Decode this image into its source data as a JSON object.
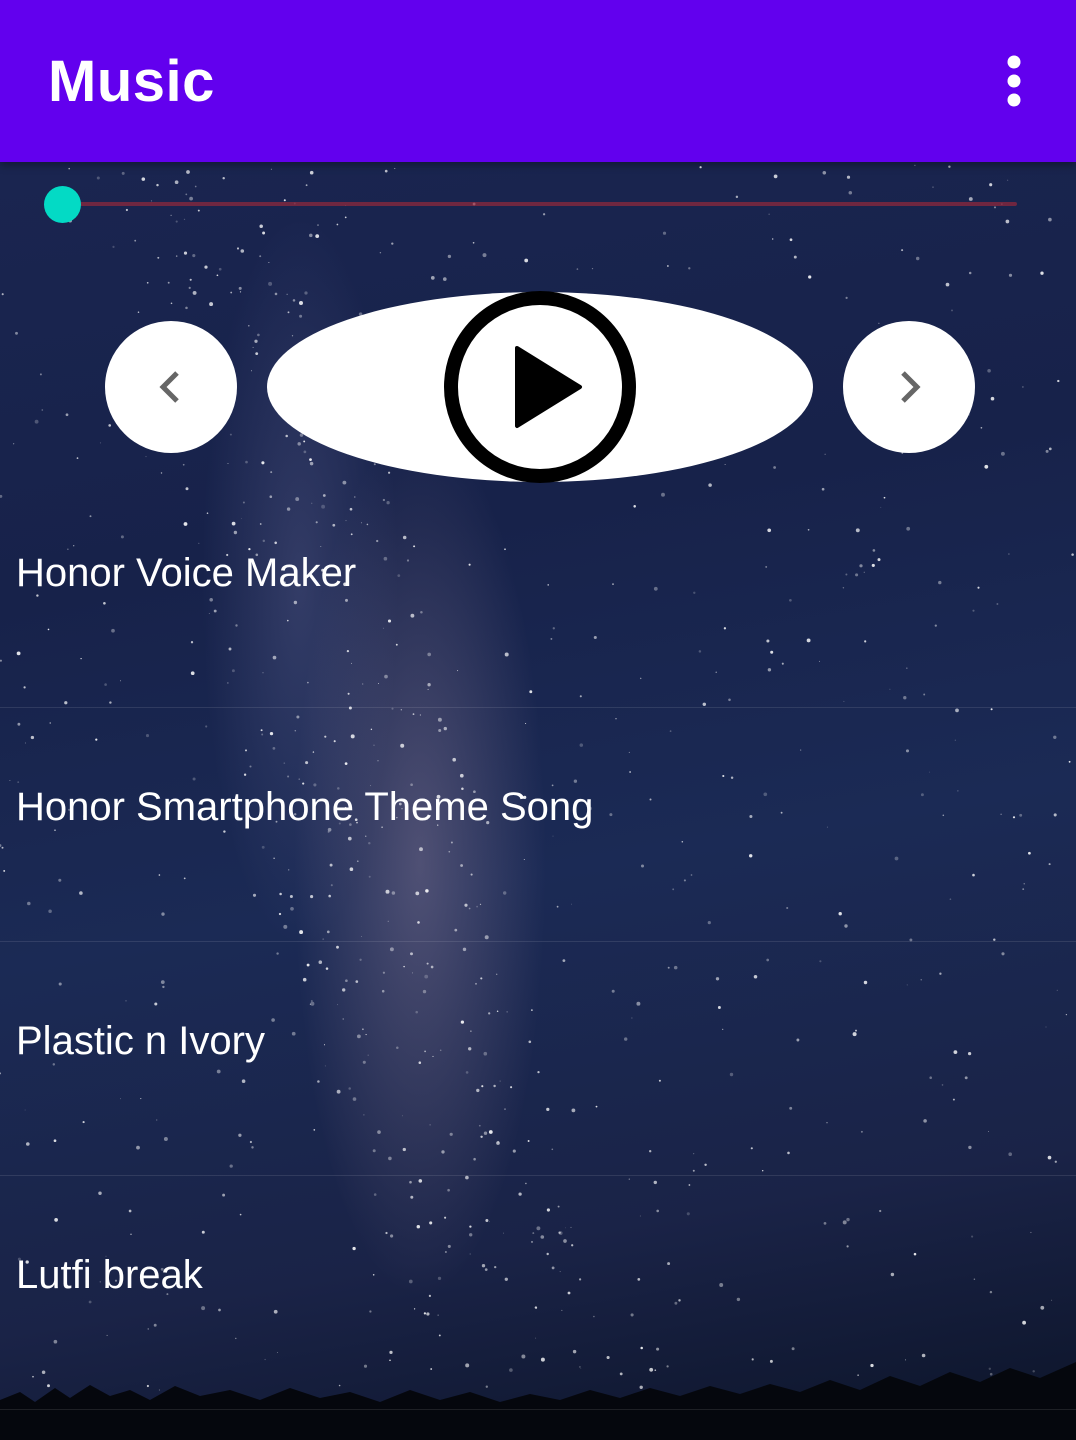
{
  "appbar": {
    "title": "Music",
    "background": "#6200EE",
    "overflow_icon": "more-vert-icon"
  },
  "player": {
    "progress_fraction": 0.0,
    "seek_thumb_color": "#03DAC5",
    "prev_icon": "chevron-left-icon",
    "play_icon": "play-circle-icon",
    "next_icon": "chevron-right-icon"
  },
  "songs": [
    {
      "title": "Honor Voice Maker"
    },
    {
      "title": "Honor Smartphone Theme Song"
    },
    {
      "title": "Plastic n Ivory"
    },
    {
      "title": "Lutfi break"
    }
  ]
}
